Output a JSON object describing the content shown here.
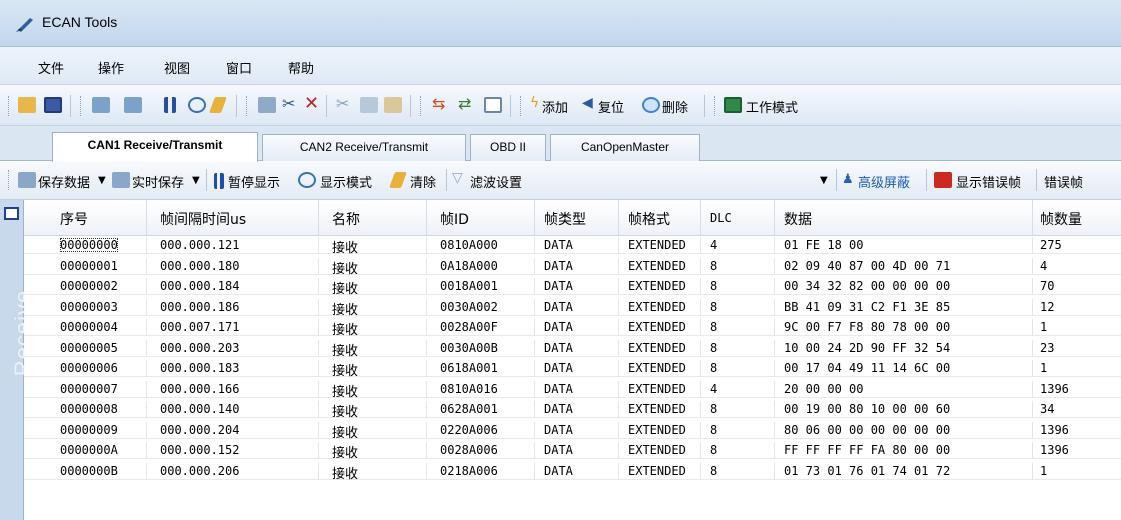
{
  "window": {
    "title": "ECAN Tools"
  },
  "menu": [
    "文件",
    "操作",
    "视图",
    "窗口",
    "帮助"
  ],
  "toolbar1": {
    "add": "添加",
    "reset": "复位",
    "delete": "删除",
    "work_mode": "工作模式"
  },
  "tabs": [
    "CAN1 Receive/Transmit",
    "CAN2 Receive/Transmit",
    "OBD II",
    "CanOpenMaster"
  ],
  "toolbar2": {
    "save_data": "保存数据",
    "realtime_save": "实时保存",
    "pause": "暂停显示",
    "display_mode": "显示模式",
    "clear": "清除",
    "filter": "滤波设置",
    "advanced_mask": "高级屏蔽",
    "show_error": "显示错误帧",
    "error_frame": "错误帧"
  },
  "side_label": "Receive",
  "table": {
    "columns": [
      "序号",
      "帧间隔时间us",
      "名称",
      "帧ID",
      "帧类型",
      "帧格式",
      "DLC",
      "数据",
      "帧数量"
    ],
    "rows": [
      [
        "00000000",
        "000.000.121",
        "接收",
        "0810A000",
        "DATA",
        "EXTENDED",
        "4",
        "01 FE 18 00",
        "275"
      ],
      [
        "00000001",
        "000.000.180",
        "接收",
        "0A18A000",
        "DATA",
        "EXTENDED",
        "8",
        "02 09 40 87 00 4D 00 71",
        "4"
      ],
      [
        "00000002",
        "000.000.184",
        "接收",
        "0018A001",
        "DATA",
        "EXTENDED",
        "8",
        "00 34 32 82 00 00 00 00",
        "70"
      ],
      [
        "00000003",
        "000.000.186",
        "接收",
        "0030A002",
        "DATA",
        "EXTENDED",
        "8",
        "BB 41 09 31 C2 F1 3E 85",
        "12"
      ],
      [
        "00000004",
        "000.007.171",
        "接收",
        "0028A00F",
        "DATA",
        "EXTENDED",
        "8",
        "9C 00 F7 F8 80 78 00 00",
        "1"
      ],
      [
        "00000005",
        "000.000.203",
        "接收",
        "0030A00B",
        "DATA",
        "EXTENDED",
        "8",
        "10 00 24 2D 90 FF 32 54",
        "23"
      ],
      [
        "00000006",
        "000.000.183",
        "接收",
        "0618A001",
        "DATA",
        "EXTENDED",
        "8",
        "00 17 04 49 11 14 6C 00",
        "1"
      ],
      [
        "00000007",
        "000.000.166",
        "接收",
        "0810A016",
        "DATA",
        "EXTENDED",
        "4",
        "20 00 00 00",
        "1396"
      ],
      [
        "00000008",
        "000.000.140",
        "接收",
        "0628A001",
        "DATA",
        "EXTENDED",
        "8",
        "00 19 00 80 10 00 00 60",
        "34"
      ],
      [
        "00000009",
        "000.000.204",
        "接收",
        "0220A006",
        "DATA",
        "EXTENDED",
        "8",
        "80 06 00 00 00 00 00 00",
        "1396"
      ],
      [
        "0000000A",
        "000.000.152",
        "接收",
        "0028A006",
        "DATA",
        "EXTENDED",
        "8",
        "FF FF FF FF FA 80 00 00",
        "1396"
      ],
      [
        "0000000B",
        "000.000.206",
        "接收",
        "0218A006",
        "DATA",
        "EXTENDED",
        "8",
        "01 73 01 76 01 74 01 72",
        "1"
      ]
    ]
  }
}
